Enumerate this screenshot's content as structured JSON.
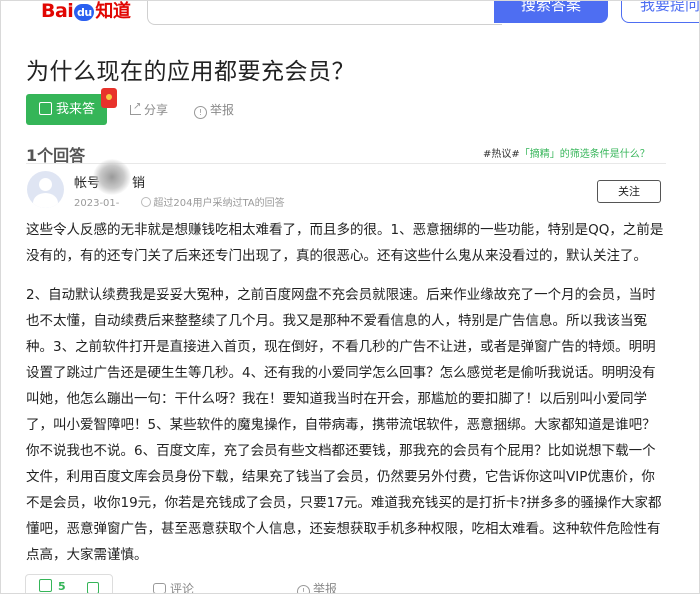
{
  "header": {
    "logo_text": "Bai",
    "logo_paw": "du",
    "logo_suffix": "知道",
    "search_button": "搜索答案",
    "ask_button": "我要提问"
  },
  "question": {
    "title": "为什么现在的应用都要充会员？",
    "answer_button": "我来答",
    "share_label": "分享",
    "report_label": "举报"
  },
  "answers_header": {
    "count_label": "1个回答",
    "hot_prefix": "#热议#",
    "hot_link": "「摘精」的筛选条件是什么？"
  },
  "answer": {
    "username": "帐号",
    "username_suffix": "销",
    "date": "2023-01-",
    "helped": "超过204用户采纳过TA的回答",
    "follow_label": "关注",
    "paragraphs": [
      "这些令人反感的无非就是想赚钱吃相太难看了，而且多的很。1、恶意捆绑的一些功能，特别是QQ，之前是没有的，有的还专门关了后来还专门出现了，真的很恶心。还有这些什么鬼从来没看过的，默认关注了。",
      "2、自动默认续费我是妥妥大冤种，之前百度网盘不充会员就限速。后来作业缘故充了一个月的会员，当时也不太懂，自动续费后来整整续了几个月。我又是那种不爱看信息的人，特别是广告信息。所以我该当冤种。3、之前软件打开是直接进入首页，现在倒好，不看几秒的广告不让进，或者是弹窗广告的特烦。明明设置了跳过广告还是硬生生等几秒。4、还有我的小爱同学怎么回事？怎么感觉老是偷听我说话。明明没有叫她，他怎么蹦出一句：干什么呀？我在！要知道我当时在开会，那尴尬的要扣脚了！以后别叫小爱同学了，叫小爱智障吧！5、某些软件的魔鬼操作，自带病毒，携带流氓软件，恶意捆绑。大家都知道是谁吧？你不说我也不说。6、百度文库，充了会员有些文档都还要钱，那我充的会员有个屁用？比如说想下载一个文件，利用百度文库会员身份下载，结果充了钱当了会员，仍然要另外付费，它告诉你这叫VIP优惠价，你不是会员，收你19元，你若是充钱成了会员，只要17元。难道我充钱买的是打折卡?拼多多的骚操作大家都懂吧，恶意弹窗广告，甚至恶意获取个人信息，还妄想获取手机多种权限，吃相太难看。这种软件危险性有点高，大家需谨慎。"
    ],
    "like_count": "5",
    "comment_label": "评论",
    "report_label": "举报"
  },
  "colors": {
    "brand_red": "#e10602",
    "brand_blue": "#4e6ef2",
    "accent_green": "#35b558"
  }
}
